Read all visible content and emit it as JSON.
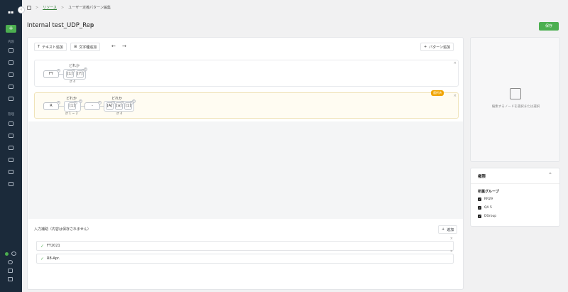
{
  "sidebar": {
    "logo": "▪▪",
    "collapse_label": "‹",
    "add_label": "+",
    "section1": "内容",
    "section2": "管理"
  },
  "breadcrumb": {
    "items": [
      "リソース",
      "ユーザー定義パターン編集"
    ]
  },
  "title": "Internal test_UDP_Rep",
  "save_label": "保存",
  "toolbar": {
    "add_text": "テキスト追加",
    "add_chartype": "文字種追加",
    "add_pattern": "パターン追加"
  },
  "patterns": [
    {
      "group_label": "どれか",
      "nodes": [
        "FY",
        "[1]",
        "[7]"
      ],
      "repeat": "4"
    },
    {
      "badge": "選択済",
      "group1_label": "どれか",
      "group1_nodes": [
        "[1]"
      ],
      "group1_repeat": "1 ~ 2",
      "node_r": "R",
      "node_dash": "-",
      "group2_label": "どれか",
      "group2_nodes": [
        "[A]",
        "[a]",
        "[1]"
      ],
      "group2_repeat": "4"
    }
  ],
  "input": {
    "label": "入力補助（内容は保存されません）",
    "add_label": "追加",
    "samples": [
      "FY2021",
      "R8-Apr."
    ]
  },
  "empty_panel": {
    "text": "編集するノードを選択または選択"
  },
  "permissions": {
    "title": "権限",
    "group_title": "所属グループ",
    "groups": [
      "RR29",
      "QA 5",
      "DGroup"
    ]
  }
}
